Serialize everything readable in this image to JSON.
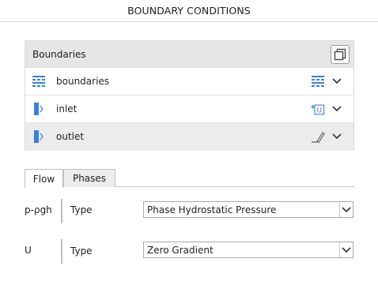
{
  "header": {
    "title": "BOUNDARY CONDITIONS"
  },
  "boundaries": {
    "title": "Boundaries",
    "copy_icon": "copy-icon",
    "items": [
      {
        "label": "boundaries",
        "icon": "patch-group-icon",
        "action_icon": "patch-group-icon",
        "selected": false
      },
      {
        "label": "inlet",
        "icon": "patch-icon",
        "action_icon": "inlet-velocity-icon",
        "action_text": "U",
        "selected": false
      },
      {
        "label": "outlet",
        "icon": "patch-icon",
        "action_icon": "pencil-icon",
        "selected": true
      }
    ]
  },
  "tabs": [
    {
      "label": "Flow",
      "active": true
    },
    {
      "label": "Phases",
      "active": false
    }
  ],
  "fields": [
    {
      "name": "p-ρgh",
      "sublabel": "Type",
      "value": "Phase Hydrostatic Pressure"
    },
    {
      "name": "U",
      "sublabel": "Type",
      "value": "Zero Gradient"
    }
  ],
  "colors": {
    "icon_blue": "#3f7fd2",
    "selected_row": "#ececec",
    "header_bg": "#e6e6e6"
  }
}
